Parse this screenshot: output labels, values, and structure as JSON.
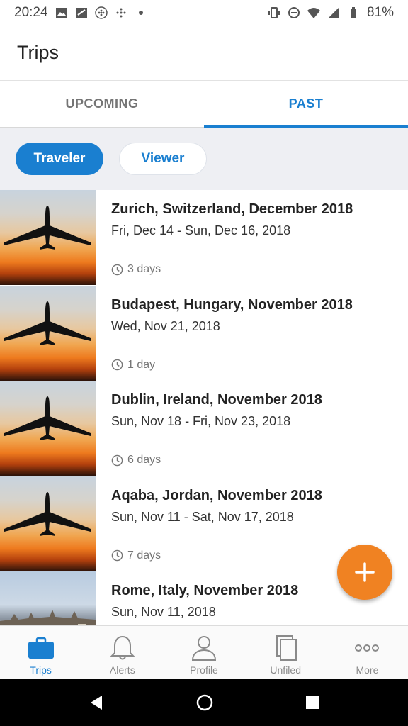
{
  "status_bar": {
    "time": "20:24",
    "battery": "81%",
    "icons_left": [
      "image-icon",
      "news-icon",
      "fitbit-icon",
      "fitbit-dots-icon",
      "dot-icon"
    ],
    "icons_right": [
      "vibrate-icon",
      "dnd-icon",
      "wifi-icon",
      "signal-icon",
      "battery-icon"
    ]
  },
  "app_bar": {
    "title": "Trips"
  },
  "tabs": [
    {
      "label": "UPCOMING",
      "active": false
    },
    {
      "label": "PAST",
      "active": true
    }
  ],
  "filters": {
    "traveler": "Traveler",
    "viewer": "Viewer",
    "selected": "Traveler"
  },
  "trips": [
    {
      "title": "Zurich, Switzerland, December 2018",
      "dates": "Fri, Dec 14 - Sun, Dec 16, 2018",
      "duration": "3 days",
      "image": "sunset"
    },
    {
      "title": "Budapest, Hungary, November 2018",
      "dates": "Wed, Nov 21, 2018",
      "duration": "1 day",
      "image": "sunset"
    },
    {
      "title": "Dublin, Ireland, November 2018",
      "dates": "Sun, Nov 18 - Fri, Nov 23, 2018",
      "duration": "6 days",
      "image": "sunset"
    },
    {
      "title": "Aqaba, Jordan, November 2018",
      "dates": "Sun, Nov 11 - Sat, Nov 17, 2018",
      "duration": "7 days",
      "image": "sunset"
    },
    {
      "title": "Rome, Italy, November 2018",
      "dates": "Sun, Nov 11, 2018",
      "duration": "",
      "image": "city"
    }
  ],
  "fab": {
    "icon": "plus-icon",
    "color": "#f08222"
  },
  "bottom_nav": [
    {
      "label": "Trips",
      "icon": "briefcase-icon",
      "active": true
    },
    {
      "label": "Alerts",
      "icon": "bell-icon",
      "active": false
    },
    {
      "label": "Profile",
      "icon": "person-icon",
      "active": false
    },
    {
      "label": "Unfiled",
      "icon": "documents-icon",
      "active": false
    },
    {
      "label": "More",
      "icon": "more-icon",
      "active": false
    }
  ],
  "colors": {
    "accent": "#1a7fd0",
    "fab": "#f08222"
  }
}
